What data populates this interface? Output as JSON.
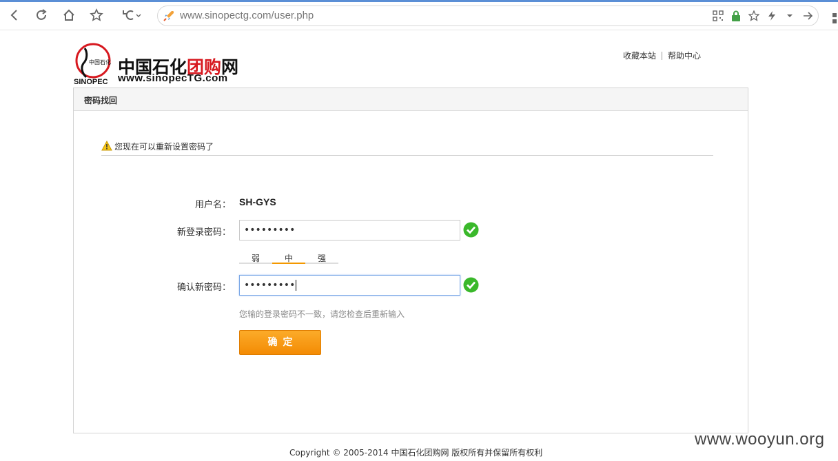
{
  "browser": {
    "url": "www.sinopectg.com/user.php"
  },
  "header": {
    "brand_black": "中国石化",
    "brand_red": "团购",
    "brand_tail": "网",
    "domain": "www.sinopecTG.com",
    "emblem_text": "SINOPEC",
    "links": [
      "收藏本站",
      "帮助中心"
    ]
  },
  "panel": {
    "title": "密码找回",
    "notice": "您现在可以重新设置密码了",
    "username_label": "用户名：",
    "username_value": "SH-GYS",
    "new_password_label": "新登录密码：",
    "new_password_value": "•••••••••",
    "strength_levels": [
      "弱",
      "中",
      "强"
    ],
    "strength_active": "中",
    "confirm_password_label": "确认新密码：",
    "confirm_password_value": "•••••••••",
    "mismatch_hint": "您输的登录密码不一致，请您检查后重新输入",
    "submit_label": "确定"
  },
  "footer": {
    "copyright": "Copyright © 2005-2014 中国石化团购网 版权所有并保留所有权利"
  },
  "watermark": "www.wooyun.org",
  "colors": {
    "accent_orange": "#f39800",
    "brand_red": "#d71920",
    "ok_green": "#3ab82b"
  }
}
